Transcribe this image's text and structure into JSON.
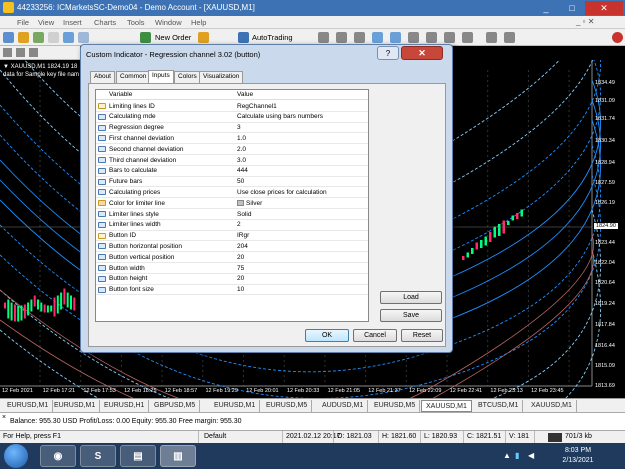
{
  "window": {
    "title": "44233256: ICMarketsSC-Demo04 - Demo Account - [XAUUSD,M1]",
    "min": "_",
    "max": "□",
    "close": "✕"
  },
  "menu": {
    "items": [
      "File",
      "View",
      "Insert",
      "Charts",
      "Tools",
      "Window",
      "Help"
    ],
    "right_controls": "_ ▫ ✕"
  },
  "toolbar": {
    "new_order": "New Order",
    "autotrading": "AutoTrading"
  },
  "chart": {
    "symbol_label": "▼ XAUUSD,M1  1824.19 18",
    "sub_label": "data for Sample key file nam",
    "current_price": "1824.90",
    "price_ticks": [
      "1834.49",
      "1831.09",
      "1831.74",
      "1830.34",
      "1828.94",
      "1827.59",
      "1826.19",
      "1824.90",
      "1823.44",
      "1822.04",
      "1820.64",
      "1819.24",
      "1817.84",
      "1816.44",
      "1815.09",
      "1813.69"
    ],
    "time_ticks": [
      "12 Feb 2021",
      "12 Feb 17:21",
      "12 Feb 17:53",
      "12 Feb 18:25",
      "12 Feb 18:57",
      "12 Feb 19:29",
      "12 Feb 20:01",
      "12 Feb 20:33",
      "12 Feb 21:05",
      "12 Feb 21:37",
      "12 Feb 22:09",
      "12 Feb 22:41",
      "12 Feb 23:13",
      "12 Feb 23:45"
    ]
  },
  "tabs": [
    "EURUSD,M1",
    "EURUSD,M1",
    "EURUSD,H1",
    "GBPUSD,M5",
    "EURUSD,M1",
    "EURUSD,M5",
    "AUDUSD,M1",
    "EURUSD,M5",
    "XAUUSD,M1",
    "BTCUSD,M1",
    "XAUUSD,M1"
  ],
  "active_tab_index": 8,
  "toolbox": {
    "close": "×",
    "balance_line": "Balance: 955.30 USD  Profit/Loss: 0.00  Equity: 955.30  Free margin: 955.30"
  },
  "status": {
    "help": "For Help, press F1",
    "profile": "Default",
    "datetime": "2021.02.12 20:17",
    "open": "O: 1821.03",
    "high": "H: 1821.60",
    "low": "L: 1820.93",
    "close": "C: 1821.51",
    "volume": "V: 181",
    "traffic": "701/3 kb"
  },
  "taskbar": {
    "time": "8:03 PM",
    "date": "2/13/2021"
  },
  "dialog": {
    "title": "Custom Indicator - Regression channel 3.02 (button)",
    "help": "?",
    "close": "✕",
    "tabs": [
      "About",
      "Common",
      "Inputs",
      "Colors",
      "Visualization"
    ],
    "active_tab": 2,
    "col_variable": "Variable",
    "col_value": "Value",
    "rows": [
      {
        "type": "ab",
        "name": "Limiting lines ID",
        "value": "RegChannel1"
      },
      {
        "type": "num",
        "name": "Calculating mde",
        "value": "Calculate using bars numbers"
      },
      {
        "type": "num",
        "name": "Regression degree",
        "value": "3"
      },
      {
        "type": "num",
        "name": "First channel deviation",
        "value": "1.0"
      },
      {
        "type": "num",
        "name": "Second channel deviation",
        "value": "2.0"
      },
      {
        "type": "num",
        "name": "Third channel deviation",
        "value": "3.0"
      },
      {
        "type": "num",
        "name": "Bars to calculate",
        "value": "444"
      },
      {
        "type": "num",
        "name": "Future bars",
        "value": "50"
      },
      {
        "type": "num",
        "name": "Calculating prices",
        "value": "Use close prices for calculation"
      },
      {
        "type": "clr",
        "name": "Color for limiter line",
        "value": "Silver"
      },
      {
        "type": "num",
        "name": "Limiter lines style",
        "value": "Solid"
      },
      {
        "type": "num",
        "name": "Limiter lines width",
        "value": "2"
      },
      {
        "type": "ab",
        "name": "Button ID",
        "value": "IRgr"
      },
      {
        "type": "num",
        "name": "Button horizontal position",
        "value": "204"
      },
      {
        "type": "num",
        "name": "Button vertical position",
        "value": "20"
      },
      {
        "type": "num",
        "name": "Button width",
        "value": "75"
      },
      {
        "type": "num",
        "name": "Button height",
        "value": "20"
      },
      {
        "type": "num",
        "name": "Button font size",
        "value": "10"
      }
    ],
    "load": "Load",
    "save": "Save",
    "ok": "OK",
    "cancel": "Cancel",
    "reset": "Reset"
  },
  "colors": {
    "accent": "#3d73b5",
    "chart_bg": "#000000",
    "channel_inner": "#1e90ff",
    "channel_outer": "#87cefa",
    "candle_up": "#00ff7f",
    "candle_down": "#ff2a6d"
  }
}
